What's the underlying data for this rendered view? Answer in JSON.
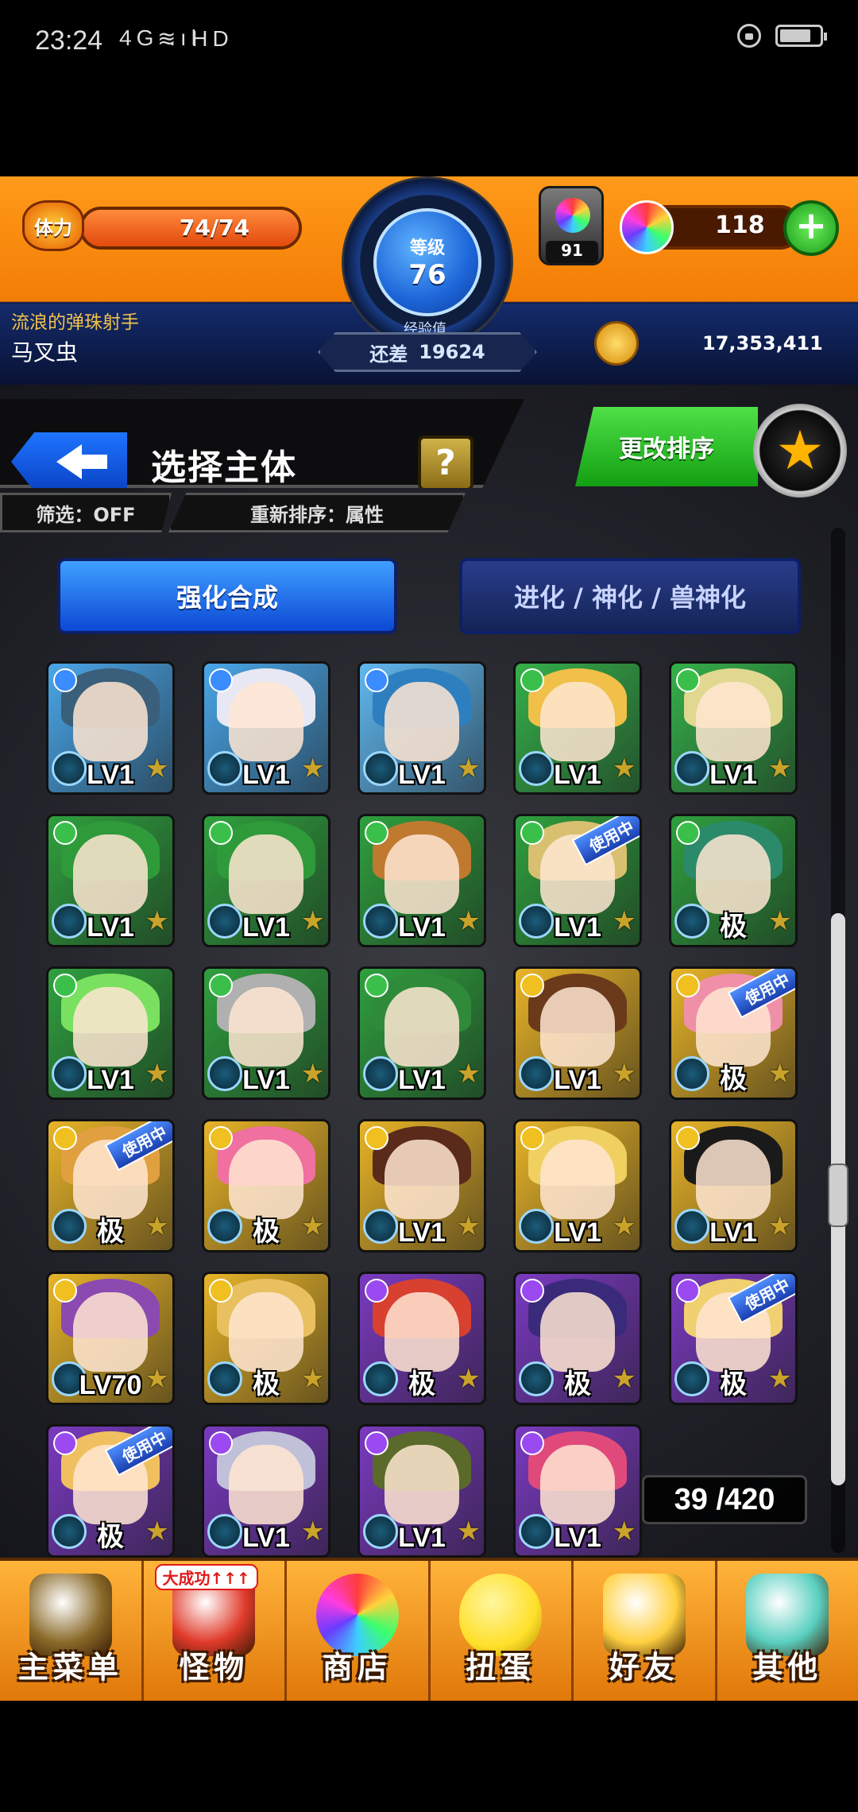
{
  "status_bar": {
    "time": "23:24",
    "network": "4G .ıl",
    "wifi": "≋ HD"
  },
  "hud": {
    "stamina_badge": "体力",
    "stamina_value": "74/74",
    "stamina_fraction": 1.0,
    "level_label": "等级",
    "level_value": "76",
    "exp_label": "经验值",
    "exp_remaining_label": "还差",
    "exp_remaining_value": "19624",
    "orb_pack_count": "91",
    "orb_count": "118",
    "plus_label": "+",
    "player_title": "流浪的弹珠射手",
    "player_name": "马叉虫",
    "coins": "17,353,411"
  },
  "screen": {
    "title": "选择主体",
    "help_label": "?",
    "filter_label": "筛选：OFF",
    "sort_label": "重新排序：属性",
    "change_sort_button": "更改排序",
    "tabs": [
      {
        "label": "强化合成",
        "active": true
      },
      {
        "label": "进化 / 神化 / 兽神化",
        "active": false
      }
    ],
    "count": "39 /420"
  },
  "monsters": [
    {
      "level": "LV1",
      "bg": "#4aa6e8",
      "hair": "#3a5f7a",
      "element": "#3a8cff",
      "in_use": false
    },
    {
      "level": "LV1",
      "bg": "#4aa6e8",
      "hair": "#e8e8f4",
      "element": "#3a8cff",
      "in_use": false
    },
    {
      "level": "LV1",
      "bg": "#60b8f0",
      "hair": "#2e7fc0",
      "element": "#3a8cff",
      "in_use": false
    },
    {
      "level": "LV1",
      "bg": "#35b04a",
      "hair": "#f0c048",
      "element": "#3ac04a",
      "in_use": false
    },
    {
      "level": "LV1",
      "bg": "#35b04a",
      "hair": "#e0d890",
      "element": "#3ac04a",
      "in_use": false
    },
    {
      "level": "LV1",
      "bg": "#2fa03e",
      "hair": "#2f9a3a",
      "element": "#3ac04a",
      "in_use": false
    },
    {
      "level": "LV1",
      "bg": "#2fa03e",
      "hair": "#2f9a3a",
      "element": "#3ac04a",
      "in_use": false
    },
    {
      "level": "LV1",
      "bg": "#2fa03e",
      "hair": "#c07a30",
      "element": "#3ac04a",
      "in_use": false
    },
    {
      "level": "LV1",
      "bg": "#2fa03e",
      "hair": "#d8c070",
      "element": "#3ac04a",
      "in_use": true
    },
    {
      "level": "极",
      "bg": "#2fa03e",
      "hair": "#2a8a6a",
      "element": "#3ac04a",
      "in_use": false
    },
    {
      "level": "LV1",
      "bg": "#2fa03e",
      "hair": "#7ae060",
      "element": "#3ac04a",
      "in_use": false
    },
    {
      "level": "LV1",
      "bg": "#2fa03e",
      "hair": "#b0b0b0",
      "element": "#3ac04a",
      "in_use": false
    },
    {
      "level": "LV1",
      "bg": "#2fa03e",
      "hair": "#2f8a3a",
      "element": "#3ac04a",
      "in_use": false
    },
    {
      "level": "LV1",
      "bg": "#e8b428",
      "hair": "#6a3a1a",
      "element": "#f0c020",
      "in_use": false
    },
    {
      "level": "极",
      "bg": "#e8b428",
      "hair": "#f090a8",
      "element": "#f0c020",
      "in_use": true
    },
    {
      "level": "极",
      "bg": "#e8b428",
      "hair": "#e0a040",
      "element": "#f0c020",
      "in_use": true
    },
    {
      "level": "极",
      "bg": "#e8b428",
      "hair": "#f070a0",
      "element": "#f0c020",
      "in_use": false
    },
    {
      "level": "LV1",
      "bg": "#e8b428",
      "hair": "#5a2a1a",
      "element": "#f0c020",
      "in_use": false
    },
    {
      "level": "LV1",
      "bg": "#e8b428",
      "hair": "#f0d060",
      "element": "#f0c020",
      "in_use": false
    },
    {
      "level": "LV1",
      "bg": "#e8b428",
      "hair": "#1a1a1a",
      "element": "#f0c020",
      "in_use": false
    },
    {
      "level": "LV70",
      "bg": "#e8b428",
      "hair": "#8a4ab0",
      "element": "#f0c020",
      "in_use": false
    },
    {
      "level": "极",
      "bg": "#e8b428",
      "hair": "#e8c060",
      "element": "#f0c020",
      "in_use": false
    },
    {
      "level": "极",
      "bg": "#7a3ac0",
      "hair": "#d84030",
      "element": "#9a4af0",
      "in_use": false
    },
    {
      "level": "极",
      "bg": "#7a3ac0",
      "hair": "#3a2a7a",
      "element": "#9a4af0",
      "in_use": false
    },
    {
      "level": "极",
      "bg": "#7a3ac0",
      "hair": "#f0d070",
      "element": "#9a4af0",
      "in_use": true
    },
    {
      "level": "极",
      "bg": "#7a3ac0",
      "hair": "#f0c060",
      "element": "#9a4af0",
      "in_use": true
    },
    {
      "level": "LV1",
      "bg": "#7a3ac0",
      "hair": "#c0c0d8",
      "element": "#9a4af0",
      "in_use": false
    },
    {
      "level": "LV1",
      "bg": "#7a3ac0",
      "hair": "#5a6a2a",
      "element": "#9a4af0",
      "in_use": false
    },
    {
      "level": "LV1",
      "bg": "#7a3ac0",
      "hair": "#e04a7a",
      "element": "#9a4af0",
      "in_use": false
    }
  ],
  "in_use_label": "使用中",
  "bottom_nav": [
    {
      "name": "nav-main-menu",
      "icon": "gate-icon",
      "label": "主菜单",
      "color": "#8a6a2a"
    },
    {
      "name": "nav-monsters",
      "icon": "monster-icon",
      "label": "怪物",
      "color": "#e03a2a",
      "badge": "大成功↑↑↑"
    },
    {
      "name": "nav-shop",
      "icon": "orb-icon",
      "label": "商店",
      "color": "#a06aff"
    },
    {
      "name": "nav-gacha",
      "icon": "egg-icon",
      "label": "扭蛋",
      "color": "#ffe02a"
    },
    {
      "name": "nav-friends",
      "icon": "friends-icon",
      "label": "好友",
      "color": "#ffd040"
    },
    {
      "name": "nav-other",
      "icon": "question-icon",
      "label": "其他",
      "color": "#5ad0c0"
    }
  ]
}
